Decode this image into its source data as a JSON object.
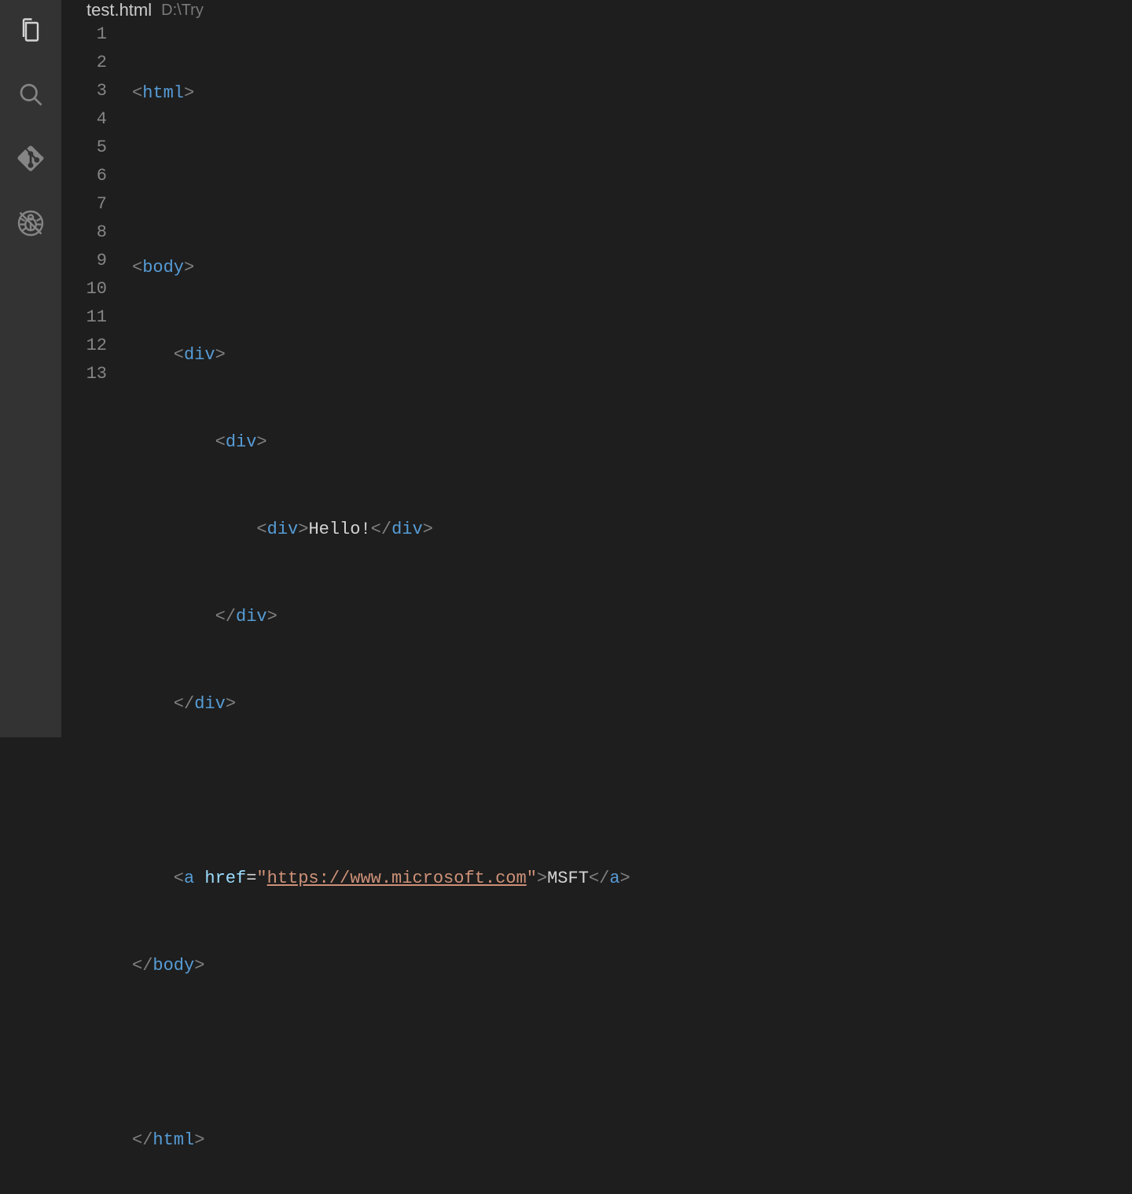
{
  "activityBar": {
    "items": [
      {
        "name": "files-icon",
        "active": true
      },
      {
        "name": "search-icon",
        "active": false
      },
      {
        "name": "git-icon",
        "active": false
      },
      {
        "name": "debug-icon",
        "active": false
      }
    ]
  },
  "tab": {
    "filename": "test.html",
    "path": "D:\\Try"
  },
  "editor": {
    "lineCount": 13,
    "lineNumbers": [
      "1",
      "2",
      "3",
      "4",
      "5",
      "6",
      "7",
      "8",
      "9",
      "10",
      "11",
      "12",
      "13"
    ],
    "source": {
      "l1": {
        "tag": "html"
      },
      "l3": {
        "tag": "body"
      },
      "l4": {
        "tag": "div"
      },
      "l5": {
        "tag": "div"
      },
      "l6": {
        "openTag": "div",
        "text": "Hello!",
        "closeTag": "div"
      },
      "l7": {
        "tag": "div"
      },
      "l8": {
        "tag": "div"
      },
      "l10": {
        "openTag": "a",
        "attr": "href",
        "eq": "=",
        "q": "\"",
        "url": "https://www.microsoft.com",
        "text": "MSFT",
        "closeTag": "a"
      },
      "l11": {
        "tag": "body"
      },
      "l13": {
        "tag": "html"
      }
    }
  },
  "punct": {
    "lt": "<",
    "gt": ">",
    "ltSlash": "</"
  }
}
